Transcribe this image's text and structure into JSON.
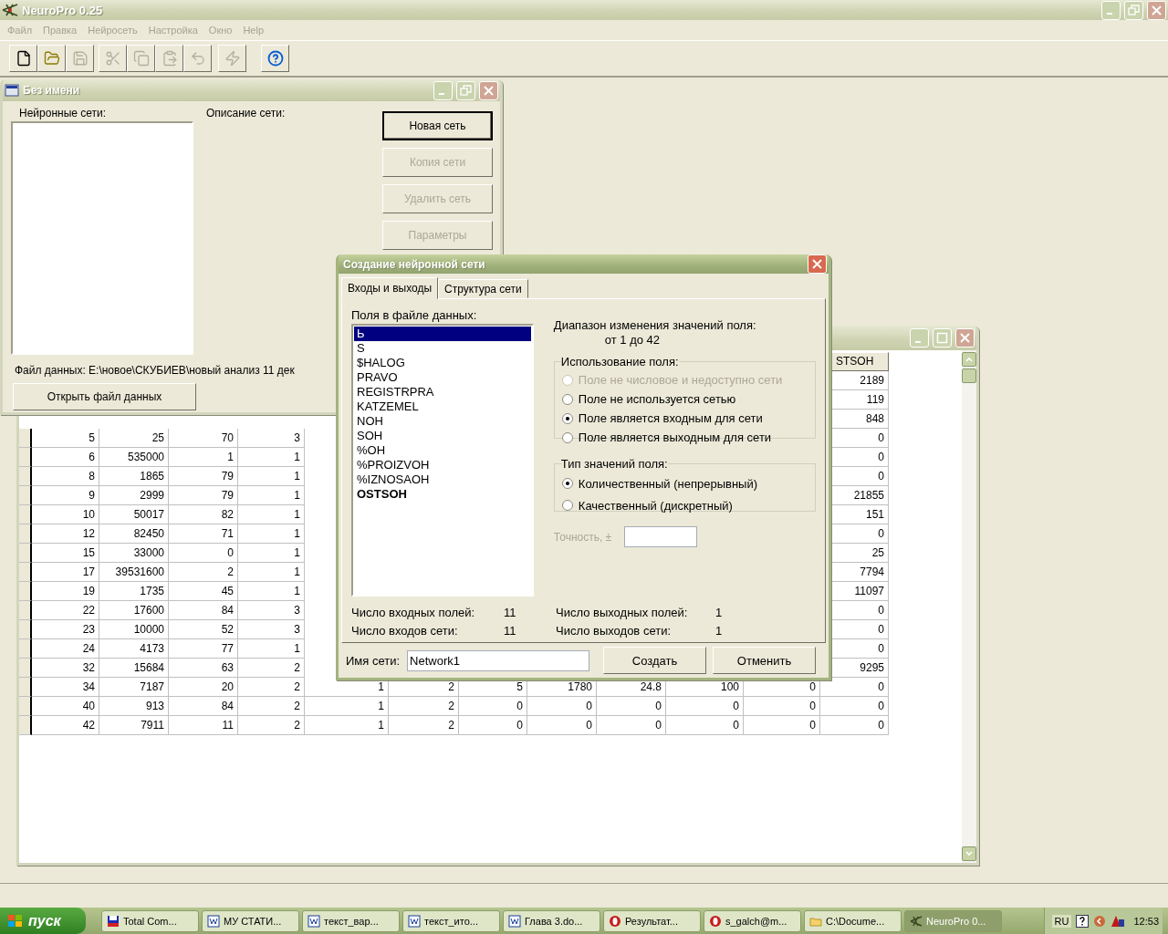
{
  "app": {
    "title": "NeuroPro 0.25"
  },
  "menu": [
    {
      "label": "Файл",
      "disabled": true
    },
    {
      "label": "Правка",
      "disabled": true
    },
    {
      "label": "Нейросеть",
      "disabled": true
    },
    {
      "label": "Настройка",
      "disabled": true
    },
    {
      "label": "Окно",
      "disabled": true
    },
    {
      "label": "Help",
      "disabled": true
    }
  ],
  "toolbar": [
    {
      "kind": "new",
      "disabled": false
    },
    {
      "kind": "open",
      "disabled": false
    },
    {
      "kind": "save",
      "disabled": true
    },
    {
      "kind": "cut",
      "disabled": true
    },
    {
      "kind": "copy",
      "disabled": true
    },
    {
      "kind": "paste",
      "disabled": true
    },
    {
      "kind": "undo",
      "disabled": true
    },
    {
      "kind": "run",
      "disabled": true
    },
    {
      "kind": "help",
      "disabled": false
    }
  ],
  "networks_window": {
    "title": "Без имени",
    "networks_label": "Нейронные сети:",
    "description_label": "Описание сети:",
    "buttons": [
      {
        "label": "Новая сеть",
        "default": true,
        "disabled": false
      },
      {
        "label": "Копия сети",
        "default": false,
        "disabled": true
      },
      {
        "label": "Удалить сеть",
        "default": false,
        "disabled": true
      },
      {
        "label": "Параметры",
        "default": false,
        "disabled": true
      }
    ],
    "data_file": "Файл данных: E:\\новое\\СКУБИЕВ\\новый анализ 11 дек",
    "open_button": "Открыть файл данных"
  },
  "data_window": {
    "columns": [
      null,
      null,
      null,
      null,
      null,
      null,
      null,
      null,
      null,
      null,
      null,
      "STSOH"
    ],
    "rows": [
      [
        null,
        null,
        null,
        null,
        null,
        null,
        null,
        null,
        null,
        null,
        null,
        "2189"
      ],
      [
        null,
        null,
        null,
        null,
        null,
        null,
        null,
        null,
        null,
        null,
        null,
        "119"
      ],
      [
        null,
        null,
        null,
        null,
        null,
        null,
        null,
        null,
        null,
        null,
        null,
        "848"
      ],
      [
        "5",
        "25",
        "70",
        "3",
        null,
        null,
        null,
        null,
        null,
        null,
        null,
        "0"
      ],
      [
        "6",
        "535000",
        "1",
        "1",
        null,
        null,
        null,
        null,
        null,
        null,
        null,
        "0"
      ],
      [
        "8",
        "1865",
        "79",
        "1",
        null,
        null,
        null,
        null,
        null,
        null,
        null,
        "0"
      ],
      [
        "9",
        "2999",
        "79",
        "1",
        null,
        null,
        null,
        null,
        null,
        null,
        null,
        "21855"
      ],
      [
        "10",
        "50017",
        "82",
        "1",
        null,
        null,
        null,
        null,
        null,
        null,
        null,
        "151"
      ],
      [
        "12",
        "82450",
        "71",
        "1",
        null,
        null,
        null,
        null,
        null,
        null,
        null,
        "0"
      ],
      [
        "15",
        "33000",
        "0",
        "1",
        null,
        null,
        null,
        null,
        null,
        null,
        null,
        "25"
      ],
      [
        "17",
        "39531600",
        "2",
        "1",
        null,
        null,
        null,
        null,
        null,
        null,
        null,
        "7794"
      ],
      [
        "19",
        "1735",
        "45",
        "1",
        null,
        null,
        null,
        null,
        null,
        null,
        null,
        "11097"
      ],
      [
        "22",
        "17600",
        "84",
        "3",
        null,
        null,
        null,
        null,
        null,
        null,
        null,
        "0"
      ],
      [
        "23",
        "10000",
        "52",
        "3",
        null,
        null,
        null,
        null,
        null,
        null,
        null,
        "0"
      ],
      [
        "24",
        "4173",
        "77",
        "1",
        null,
        null,
        null,
        null,
        null,
        null,
        null,
        "0"
      ],
      [
        "32",
        "15684",
        "63",
        "2",
        null,
        null,
        null,
        null,
        null,
        null,
        null,
        "9295"
      ],
      [
        "34",
        "7187",
        "20",
        "2",
        "1",
        "2",
        "5",
        "1780",
        "24.8",
        "100",
        "0",
        "0"
      ],
      [
        "40",
        "913",
        "84",
        "2",
        "1",
        "2",
        "0",
        "0",
        "0",
        "0",
        "0",
        "0"
      ],
      [
        "42",
        "7911",
        "11",
        "2",
        "1",
        "2",
        "0",
        "0",
        "0",
        "0",
        "0",
        "0"
      ]
    ]
  },
  "dialog": {
    "title": "Создание нейронной сети",
    "tabs": [
      {
        "label": "Входы и выходы",
        "selected": true
      },
      {
        "label": "Структура сети",
        "selected": false
      }
    ],
    "fields_label": "Поля в файле данных:",
    "fields": [
      {
        "name": "Ь",
        "selected": true,
        "output": false
      },
      {
        "name": "S",
        "selected": false,
        "output": false
      },
      {
        "name": "$HALOG",
        "selected": false,
        "output": false
      },
      {
        "name": "PRAVO",
        "selected": false,
        "output": false
      },
      {
        "name": "REGISTRPRA",
        "selected": false,
        "output": false
      },
      {
        "name": "KATZEMEL",
        "selected": false,
        "output": false
      },
      {
        "name": "NOH",
        "selected": false,
        "output": false
      },
      {
        "name": "SOH",
        "selected": false,
        "output": false
      },
      {
        "name": "%OH",
        "selected": false,
        "output": false
      },
      {
        "name": "%PROIZVOH",
        "selected": false,
        "output": false
      },
      {
        "name": "%IZNOSAOH",
        "selected": false,
        "output": false
      },
      {
        "name": "OSTSOH",
        "selected": false,
        "output": true
      }
    ],
    "range_label": "Диапазон изменения значений поля:",
    "range_value": "от 1 до 42",
    "usage": {
      "title": "Использование поля:",
      "options": [
        {
          "label": "Поле не числовое и недоступно сети",
          "checked": false,
          "disabled": true
        },
        {
          "label": "Поле не используется сетью",
          "checked": false,
          "disabled": false
        },
        {
          "label": "Поле является входным для сети",
          "checked": true,
          "disabled": false
        },
        {
          "label": "Поле является выходным для сети",
          "checked": false,
          "disabled": false
        }
      ]
    },
    "value_type": {
      "title": "Тип значений поля:",
      "options": [
        {
          "label": "Количественный (непрерывный)",
          "checked": true,
          "disabled": false
        },
        {
          "label": "Качественный (дискретный)",
          "checked": false,
          "disabled": false
        }
      ]
    },
    "precision": {
      "label": "Точность, ±",
      "disabled": true
    },
    "counts": [
      {
        "label": "Число входных полей:",
        "value": "11"
      },
      {
        "label": "Число выходных полей:",
        "value": "1"
      },
      {
        "label": "Число входов сети:",
        "value": "11"
      },
      {
        "label": "Число выходов сети:",
        "value": "1"
      }
    ],
    "name_label": "Имя сети:",
    "name_value": "Network1",
    "buttons": [
      "Создать",
      "Отменить"
    ]
  },
  "taskbar": {
    "start": "пуск",
    "tasks": [
      {
        "label": "Total Com...",
        "kind": "commander",
        "selected": false
      },
      {
        "label": "МУ СТАТИ...",
        "kind": "word",
        "selected": false
      },
      {
        "label": "текст_вар...",
        "kind": "word",
        "selected": false
      },
      {
        "label": "текст_ито...",
        "kind": "word",
        "selected": false
      },
      {
        "label": "Глава 3.do...",
        "kind": "word",
        "selected": false
      },
      {
        "label": "Результат...",
        "kind": "opera",
        "selected": false
      },
      {
        "label": "s_galch@m...",
        "kind": "opera",
        "selected": false
      },
      {
        "label": "C:\\Docume...",
        "kind": "folder",
        "selected": false
      },
      {
        "label": "NeuroPro 0...",
        "kind": "neuropro",
        "selected": true
      }
    ],
    "language": "RU",
    "clock": "12:53"
  }
}
